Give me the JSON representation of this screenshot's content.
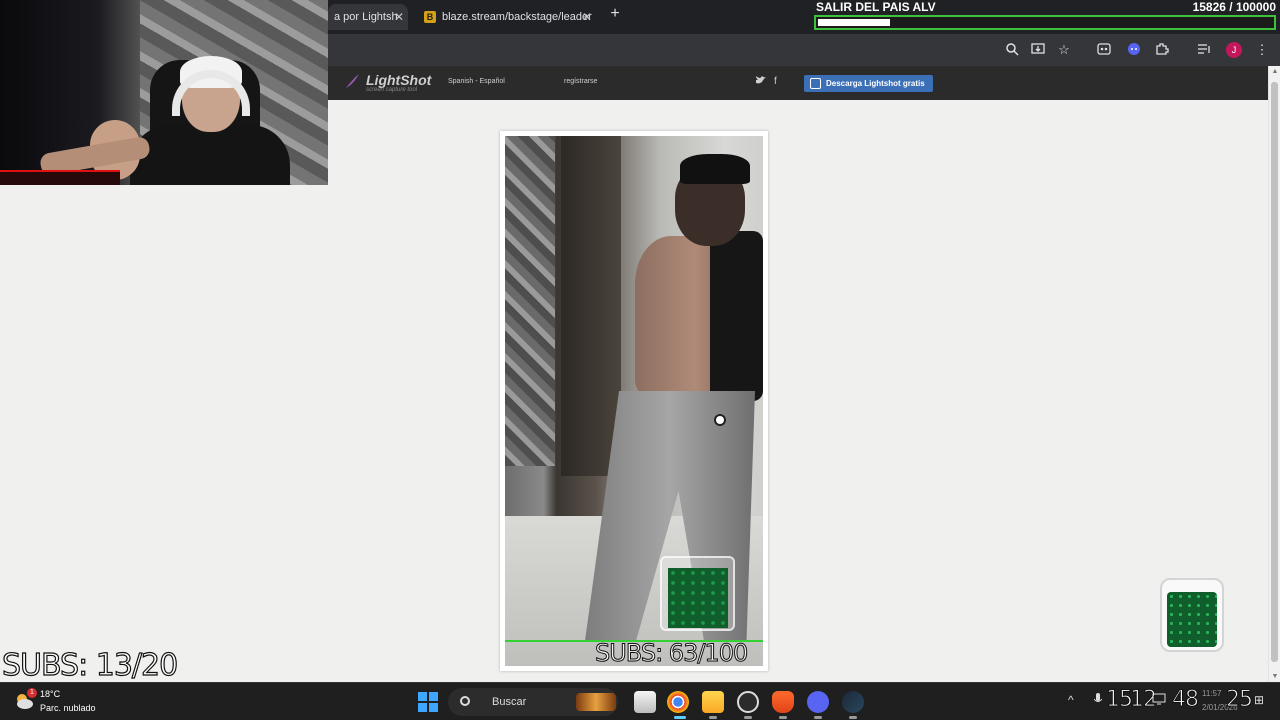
{
  "browser": {
    "tabs": [
      {
        "label": "a por Lightsh"
      },
      {
        "label": "blaze.stream/backstage/leader"
      }
    ],
    "new_tab": "+",
    "tab_close": "✕",
    "profile_initial": "J"
  },
  "goal_overlay": {
    "title": "SALIR DEL PAIS ALV",
    "current": 15826,
    "target": 100000,
    "count_text": "15826 / 100000",
    "progress_fraction": 0.158
  },
  "lightshot": {
    "logo": "LightShot",
    "tagline": "screen capture tool",
    "language": "Spanish - Español",
    "register": "regístrarse",
    "twitter": "🐦",
    "facebook": "f",
    "download_button": "Descarga Lightshot gratis"
  },
  "screenshot_overlay": {
    "subs_text": "SUBS: 63/100"
  },
  "stream_overlay": {
    "subs_counter": "SUBS: 13/20"
  },
  "taskbar": {
    "temperature": "18°C",
    "condition": "Parc. nublado",
    "weather_badge": "1",
    "search_label": "Buscar",
    "clock_numbers": [
      "15",
      "12",
      "48",
      "25"
    ],
    "time_small": "11:57",
    "date_small": "2/01/2026",
    "apps": [
      "windows-start",
      "search",
      "task-view",
      "chrome",
      "file-explorer",
      "obs",
      "brave",
      "discord",
      "steam"
    ]
  },
  "colors": {
    "goal_border": "#3ec23e",
    "download_button": "#3b6fb6",
    "windows_blue": "#3ea6ff"
  }
}
